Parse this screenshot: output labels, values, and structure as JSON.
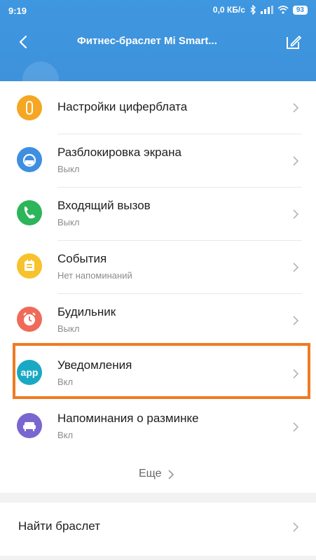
{
  "status": {
    "time": "9:19",
    "speed": "0,0 КБ/с",
    "battery": "93"
  },
  "header": {
    "title": "Фитнес-браслет Mi Smart..."
  },
  "items": [
    {
      "label": "Настройки циферблата",
      "sub": "",
      "color": "#f5a623",
      "icon": "watch-face-icon"
    },
    {
      "label": "Разблокировка экрана",
      "sub": "Выкл",
      "color": "#3f8fe0",
      "icon": "unlock-icon"
    },
    {
      "label": "Входящий вызов",
      "sub": "Выкл",
      "color": "#2cb55a",
      "icon": "phone-icon"
    },
    {
      "label": "События",
      "sub": "Нет напоминаний",
      "color": "#f7c22b",
      "icon": "calendar-icon"
    },
    {
      "label": "Будильник",
      "sub": "Выкл",
      "color": "#f06a5a",
      "icon": "alarm-icon"
    },
    {
      "label": "Уведомления",
      "sub": "Вкл",
      "color": "#1aa9c4",
      "icon": "app-icon",
      "icon_text": "app"
    },
    {
      "label": "Напоминания о разминке",
      "sub": "Вкл",
      "color": "#7a66d0",
      "icon": "sofa-icon"
    }
  ],
  "more_label": "Еще",
  "find_label": "Найти браслет",
  "colors": {
    "header": "#3e93dc",
    "highlight": "#f07a23"
  }
}
